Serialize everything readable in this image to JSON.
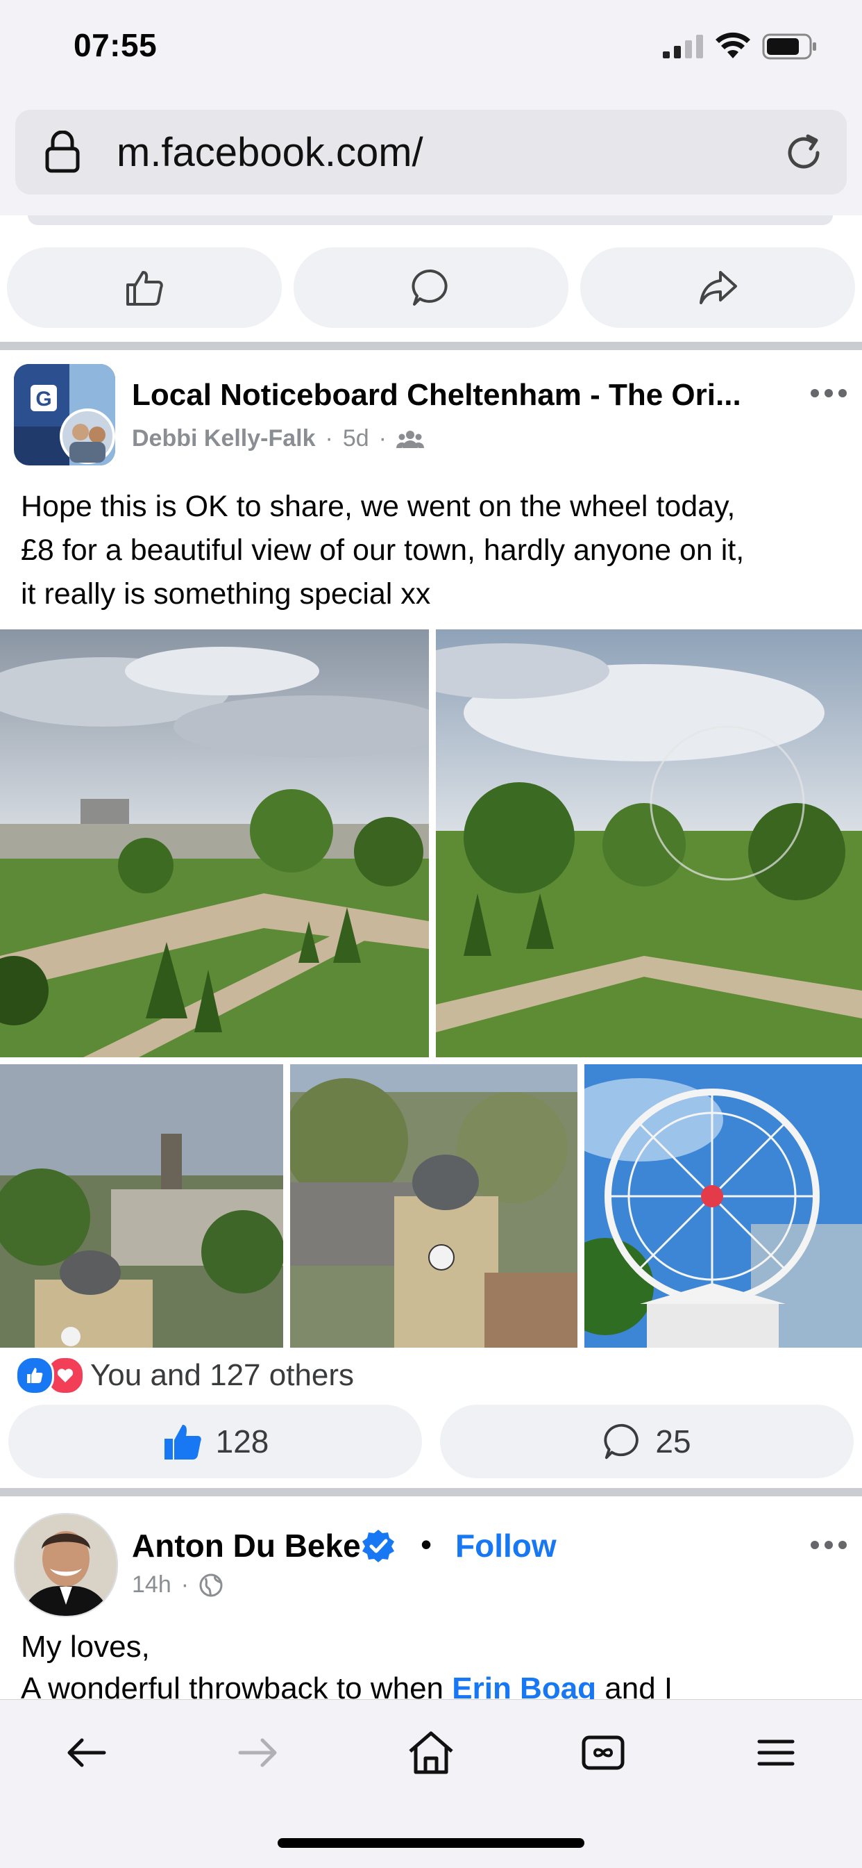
{
  "status_bar": {
    "time": "07:55"
  },
  "browser": {
    "url": "m.facebook.com/"
  },
  "post1": {
    "group_name": "Local Noticeboard Cheltenham - The Ori...",
    "author": "Debbi Kelly-Falk",
    "time": "5d",
    "text_lines": [
      "Hope this is OK to share, we went on the wheel today,",
      "£8 for a beautiful view of our town, hardly anyone on it,",
      "it really is something special xx"
    ],
    "reactions_summary": "You and 127 others",
    "like_count": "128",
    "comment_count": "25"
  },
  "post2": {
    "name": "Anton Du Beke",
    "follow_label": "Follow",
    "separator": "•",
    "time": "14h",
    "text_line1": "My loves,",
    "text_line2_start": "A wonderful throwback to when ",
    "text_line2_tag": "Erin Boag",
    "text_line2_end": " and I"
  },
  "colors": {
    "accent": "#1877f2",
    "background": "#ffffff",
    "toolbar": "#f2f2f7"
  }
}
